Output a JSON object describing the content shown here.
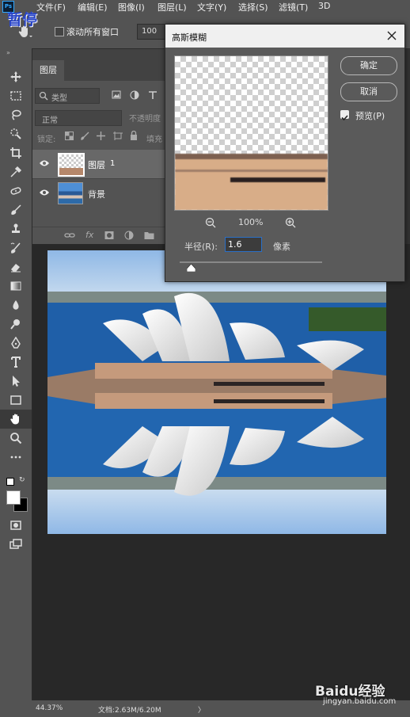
{
  "app": {
    "logo": "Ps",
    "overlay_label": "暂停"
  },
  "menu": [
    "文件(F)",
    "编辑(E)",
    "图像(I)",
    "图层(L)",
    "文字(Y)",
    "选择(S)",
    "滤镜(T)",
    "3D"
  ],
  "options": {
    "scroll_all_label": "滚动所有窗口",
    "zoom_value": "100"
  },
  "layers_panel": {
    "tab": "图层",
    "filter_placeholder": "类型",
    "blend_mode": "正常",
    "opacity_label": "不透明度",
    "lock_label": "锁定:",
    "fill_label": "填充",
    "layers": [
      {
        "name": "图层",
        "suffix": "1"
      },
      {
        "name": "背景",
        "suffix": ""
      }
    ],
    "footer_fx": "fx"
  },
  "dialog": {
    "title": "高斯模糊",
    "ok": "确定",
    "cancel": "取消",
    "preview_label": "预览(P)",
    "preview_checked": true,
    "zoom_percent": "100%",
    "radius_label": "半径(R):",
    "radius_value": "1.6",
    "radius_unit": "像素",
    "radius_slider_fraction": 0.08
  },
  "status": {
    "zoom": "44.37%",
    "doc": "文档:2.63M/6.20M",
    "arrow": "〉"
  },
  "watermark": {
    "brand": "Baidu经验",
    "url": "jingyan.baidu.com"
  },
  "colors": {
    "accent": "#31a8ff",
    "ui_gray": "#535353",
    "pause_label": "#2a46c8"
  }
}
